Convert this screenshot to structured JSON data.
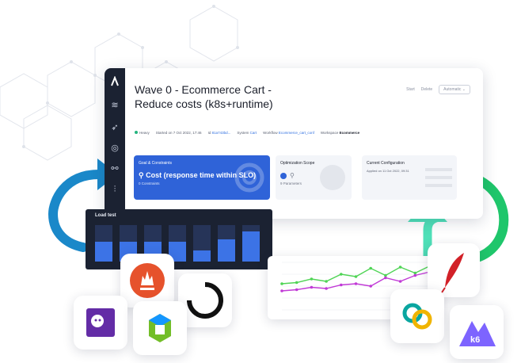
{
  "window": {
    "title": "Wave 0 - Ecommerce Cart - Reduce costs (k8s+runtime)",
    "actions": {
      "start": "Start",
      "delete": "Delete",
      "automatic": "Automatic"
    },
    "meta": {
      "status": "Heavy",
      "started": "Started on 7 Oct 2022, 17:46",
      "id_label": "Id",
      "id_value": "81a743bd...",
      "system_label": "System",
      "system_value": "Cart",
      "workflow_label": "Workflow",
      "workflow_value": "Ecommerce_cart_conf",
      "workspace_label": "Workspace",
      "workspace_value": "Ecommerce"
    },
    "cards": {
      "goal": {
        "label": "Goal & Constraints",
        "main": "Cost (response time within SLO)",
        "sub": "0 Constraints"
      },
      "scope": {
        "label": "Optimization Scope",
        "sub": "9 Parameters"
      },
      "config": {
        "label": "Current Configuration",
        "sub": "Applied on 11 Oct 2022, 09:31"
      }
    }
  },
  "loadtest": {
    "title": "Load test",
    "levels": [
      0.55,
      0.55,
      0.55,
      0.55,
      0.3,
      0.6,
      0.82
    ]
  },
  "chart_data": {
    "type": "line",
    "x": [
      1,
      2,
      3,
      4,
      5,
      6,
      7,
      8,
      9,
      10,
      11
    ],
    "series": [
      {
        "color": "#4fd455",
        "values": [
          2.2,
          2.3,
          2.6,
          2.4,
          3.0,
          2.8,
          3.5,
          2.9,
          3.6,
          3.1,
          3.7
        ]
      },
      {
        "color": "#c13ad6",
        "values": [
          1.6,
          1.7,
          1.9,
          1.8,
          2.1,
          2.2,
          2.0,
          2.7,
          2.4,
          2.9,
          3.2
        ]
      }
    ],
    "ylim": [
      0,
      4
    ]
  },
  "tiles": {
    "k6_label": "k6"
  },
  "colors": {
    "sidebar": "#1b2232",
    "accent": "#2f63d8",
    "loop_blue": "#1a88c9",
    "loop_green": "#1fc66b",
    "mint": "#4fe0b8"
  }
}
